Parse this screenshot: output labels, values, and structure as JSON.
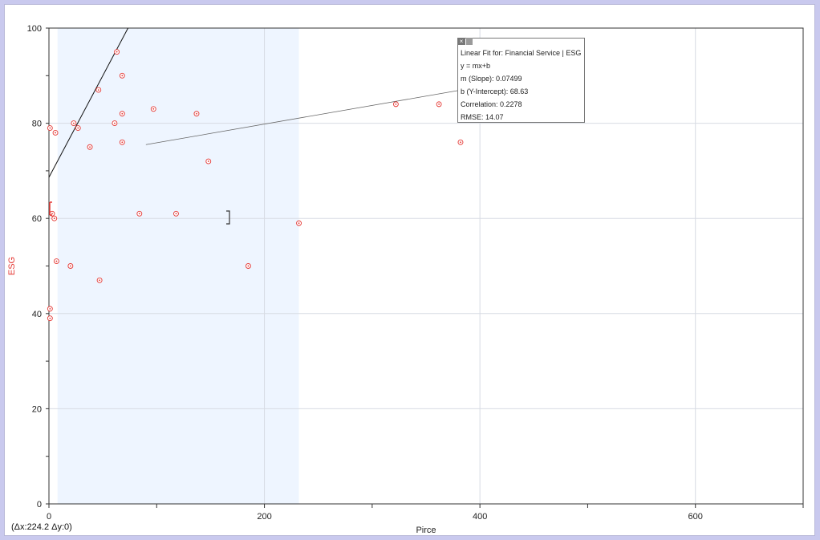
{
  "chart_data": {
    "type": "scatter",
    "xlabel": "Pirce",
    "ylabel": "ESG",
    "xlim": [
      0,
      700
    ],
    "ylim": [
      0,
      100
    ],
    "x_ticks": [
      0,
      200,
      400,
      600
    ],
    "y_ticks": [
      0,
      20,
      40,
      60,
      80,
      100
    ],
    "grid": true,
    "point_color": "#e53935",
    "highlight_color": "#eef5ff",
    "selection_range_x": [
      8,
      232
    ],
    "points": [
      {
        "x": 1,
        "y": 79
      },
      {
        "x": 6,
        "y": 78
      },
      {
        "x": 3,
        "y": 61
      },
      {
        "x": 5,
        "y": 60
      },
      {
        "x": 7,
        "y": 51
      },
      {
        "x": 1,
        "y": 41
      },
      {
        "x": 1,
        "y": 39
      },
      {
        "x": 20,
        "y": 50
      },
      {
        "x": 23,
        "y": 80
      },
      {
        "x": 27,
        "y": 79
      },
      {
        "x": 38,
        "y": 75
      },
      {
        "x": 46,
        "y": 87
      },
      {
        "x": 47,
        "y": 47
      },
      {
        "x": 61,
        "y": 80
      },
      {
        "x": 63,
        "y": 95
      },
      {
        "x": 68,
        "y": 90
      },
      {
        "x": 68,
        "y": 82
      },
      {
        "x": 68,
        "y": 76
      },
      {
        "x": 84,
        "y": 61
      },
      {
        "x": 97,
        "y": 83
      },
      {
        "x": 118,
        "y": 61
      },
      {
        "x": 137,
        "y": 82
      },
      {
        "x": 148,
        "y": 72
      },
      {
        "x": 185,
        "y": 50
      },
      {
        "x": 232,
        "y": 59
      },
      {
        "x": 322,
        "y": 84
      },
      {
        "x": 362,
        "y": 84
      },
      {
        "x": 382,
        "y": 76
      }
    ],
    "fit_line": {
      "slope": 0.07499,
      "intercept": 68.63
    }
  },
  "fit_info": {
    "title": "Linear Fit for: Financial Service | ESG",
    "equation": "y = mx+b",
    "slope": "m (Slope): 0.07499",
    "intercept": "b (Y-Intercept): 68.63",
    "correlation": "Correlation: 0.2278",
    "rmse": "RMSE: 14.07",
    "close_glyph": "×"
  },
  "delta_readout": "(Δx:224.2 Δy:0)"
}
